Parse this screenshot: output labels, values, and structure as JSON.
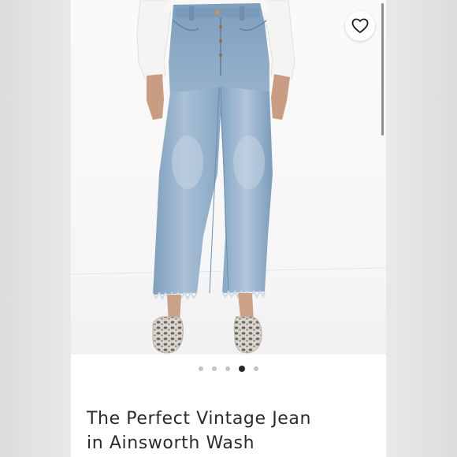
{
  "listing": {
    "title_line_1": "The Perfect Vintage Jean",
    "title_line_2": "in Ainsworth Wash",
    "is_favorited": false
  },
  "carousel": {
    "total": 5,
    "active_index": 4
  },
  "icons": {
    "favorite": "heart-outline-icon"
  },
  "colors": {
    "active_dot": "#2a2a2a",
    "inactive_dot": "#c4c4c4",
    "title_text": "#2b2b2b"
  }
}
